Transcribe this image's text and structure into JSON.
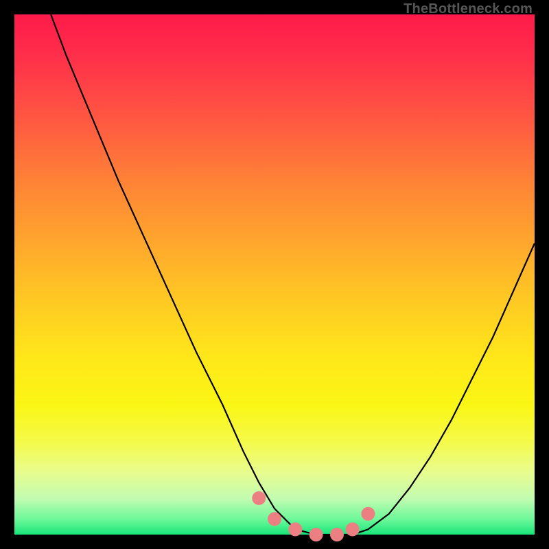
{
  "attribution": "TheBottleneck.com",
  "colors": {
    "background": "#000000",
    "curve_stroke": "#000000",
    "marker_fill": "#ec7f81",
    "marker_stroke": "#ec7f81"
  },
  "chart_data": {
    "type": "line",
    "title": "",
    "xlabel": "",
    "ylabel": "",
    "xlim": [
      0,
      100
    ],
    "ylim": [
      0,
      100
    ],
    "series": [
      {
        "name": "bottleneck-curve",
        "x": [
          7,
          10,
          15,
          20,
          25,
          30,
          35,
          40,
          44,
          47,
          50,
          54,
          58,
          62,
          65,
          68,
          72,
          76,
          80,
          84,
          88,
          92,
          96,
          100
        ],
        "values": [
          100,
          92,
          80,
          68,
          57,
          46,
          35,
          25,
          16,
          10,
          5,
          1,
          0,
          0,
          0,
          1,
          4,
          9,
          15,
          22,
          30,
          38,
          47,
          56
        ]
      }
    ],
    "markers": {
      "name": "highlighted-points",
      "x": [
        47,
        50,
        54,
        58,
        62,
        65,
        68
      ],
      "values": [
        7,
        3,
        1,
        0,
        0,
        1,
        4
      ]
    }
  }
}
